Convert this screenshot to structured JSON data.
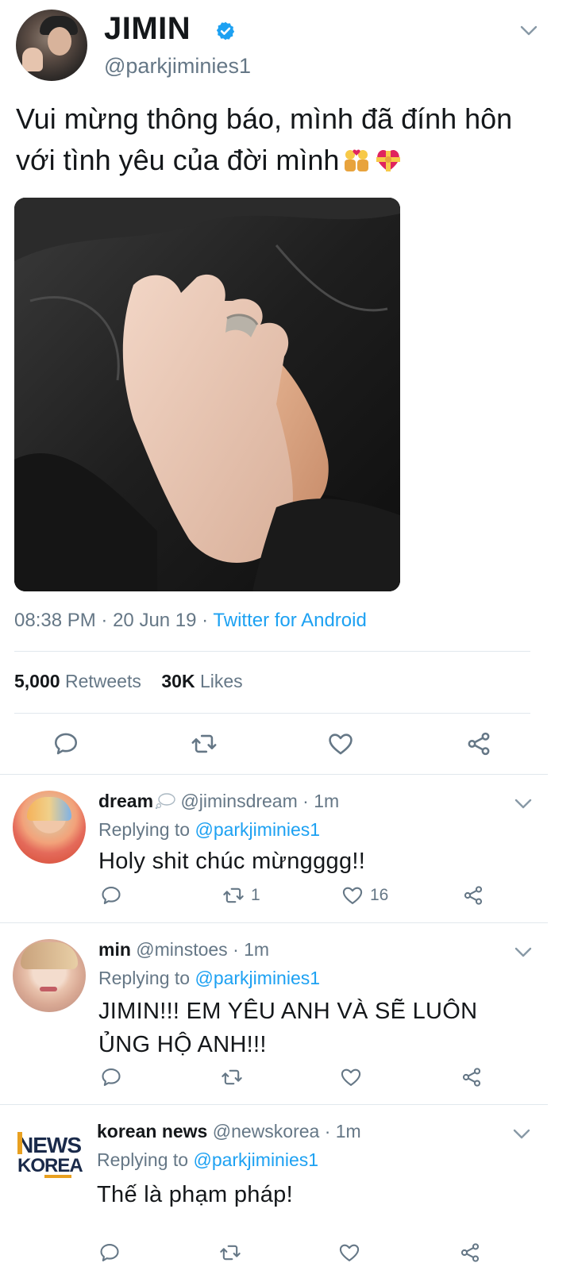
{
  "main_tweet": {
    "display_name": "JIMIN",
    "handle": "@parkjiminies1",
    "text": "Vui mừng thông báo, mình đã đính hôn với tình yêu của đời mình",
    "emojis": [
      "couple-with-heart-emoji",
      "heart-with-ribbon-emoji"
    ],
    "time": "08:38 PM",
    "date": "20 Jun 19",
    "source": "Twitter for Android",
    "retweets_count": "5,000",
    "retweets_label": "Retweets",
    "likes_count": "30K",
    "likes_label": "Likes",
    "separator": "·"
  },
  "replies": [
    {
      "name": "dream",
      "handle": "@jiminsdream",
      "time": "1m",
      "replying_label": "Replying to",
      "replying_to": "@parkjiminies1",
      "text": "Holy shit chúc mừngggg!!",
      "retweets": "1",
      "likes": "16"
    },
    {
      "name": "min",
      "handle": "@minstoes",
      "time": "1m",
      "replying_label": "Replying to",
      "replying_to": "@parkjiminies1",
      "text": "JIMIN!!! EM YÊU ANH VÀ SẼ LUÔN ỦNG HỘ ANH!!!",
      "retweets": "",
      "likes": ""
    },
    {
      "name": "korean news",
      "handle": "@newskorea",
      "time": "1m",
      "replying_label": "Replying to",
      "replying_to": "@parkjiminies1",
      "text": "Thế là phạm pháp!",
      "retweets": "",
      "likes": "",
      "logo_text": "NEWS KOREA"
    }
  ],
  "colors": {
    "accent": "#1da1f2",
    "muted": "#657786",
    "text": "#14171a",
    "divider": "#e1e8ed"
  }
}
